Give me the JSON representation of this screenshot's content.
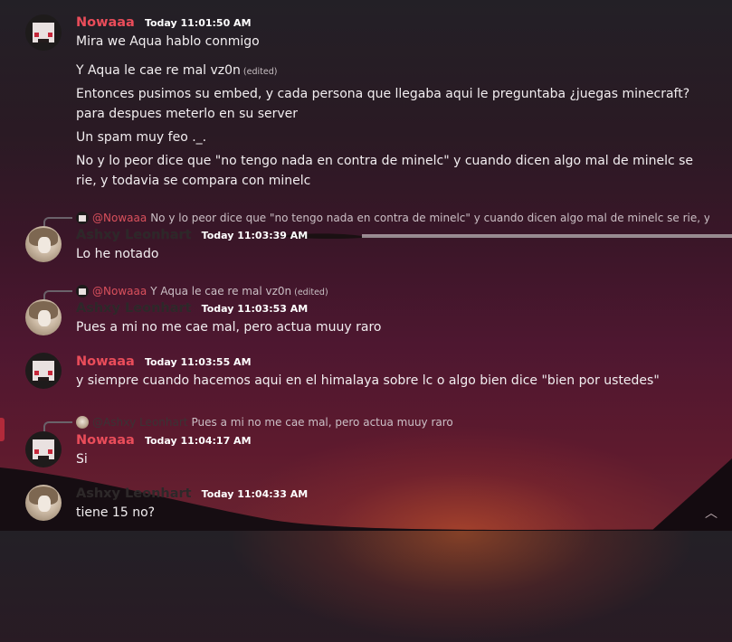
{
  "colors": {
    "accent_username": "#ea4d5a",
    "dark_username": "#2d2829",
    "text": "#f2eef0"
  },
  "messages": [
    {
      "author": "Nowaaa",
      "timestamp": "Today 11:01:50 AM",
      "lines": [
        "Mira we Aqua hablo conmigo",
        "Y Aqua le cae re mal vz0n",
        "Entonces pusimos su embed, y cada persona que llegaba aqui le preguntaba ¿juegas minecraft? para despues meterlo en su server",
        "Un spam muy feo ._.",
        "No y lo peor dice que \"no tengo nada en contra de minelc\" y cuando dicen algo mal de minelc se rie, y todavia se compara con minelc"
      ],
      "edited_label": "(edited)"
    },
    {
      "reply_to": {
        "author": "@Nowaaa",
        "text": "No y lo peor dice que \"no tengo nada en contra de minelc\" y cuando dicen algo mal de minelc se rie, y t"
      },
      "author": "Ashxy Leonhart",
      "timestamp": "Today 11:03:39 AM",
      "text": "Lo he notado"
    },
    {
      "reply_to": {
        "author": "@Nowaaa",
        "text": "Y Aqua le cae re mal vz0n",
        "edited": "(edited)"
      },
      "author": "Ashxy Leonhart",
      "timestamp": "Today 11:03:53 AM",
      "text": "Pues a mi no me cae mal, pero actua muuy raro"
    },
    {
      "author": "Nowaaa",
      "timestamp": "Today 11:03:55 AM",
      "text": "y siempre cuando hacemos aqui en el himalaya sobre lc o algo bien dice \"bien por ustedes\""
    },
    {
      "reply_to": {
        "author": "@Ashxy Leonhart",
        "text": "Pues a mi no me cae mal, pero actua muuy raro"
      },
      "author": "Nowaaa",
      "timestamp": "Today 11:04:17 AM",
      "text": "Si"
    },
    {
      "author": "Ashxy Leonhart",
      "timestamp": "Today 11:04:33 AM",
      "text": "tiene 15 no?"
    }
  ],
  "icons": {
    "avatar_pixel": "pixel-avatar-icon",
    "avatar_photo": "photo-avatar-icon",
    "scroll": "chevron-up-icon"
  },
  "scroll_up_glyph": "︿"
}
